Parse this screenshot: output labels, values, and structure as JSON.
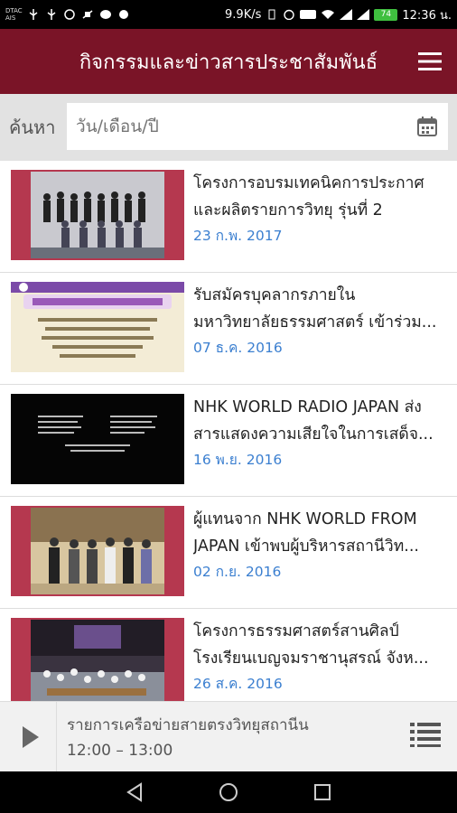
{
  "status_bar": {
    "carrier": "DTAC\nAIS",
    "speed": "9.9K/s",
    "battery": "74",
    "time": "12:36 น."
  },
  "app_bar": {
    "title": "กิจกรรมและข่าวสารประชาสัมพันธ์",
    "menu_icon": "hamburger-menu-icon"
  },
  "search": {
    "label": "ค้นหา",
    "placeholder": "วัน/เดือน/ปี",
    "calendar_icon": "calendar-icon"
  },
  "news": [
    {
      "line1": "โครงการอบรมเทคนิคการประกาศ",
      "line2": "และผลิตรายการวิทยุ รุ่นที่ 2",
      "date": "23 ก.พ. 2017"
    },
    {
      "line1": "รับสมัครบุคลากรภายใน",
      "line2": "มหาวิทยาลัยธรรมศาสตร์ เข้าร่วม...",
      "date": "07 ธ.ค. 2016"
    },
    {
      "line1": "NHK WORLD RADIO JAPAN ส่ง",
      "line2": "สารแสดงความเสียใจในการเสด็จ...",
      "date": "16 พ.ย. 2016"
    },
    {
      "line1": "ผู้แทนจาก NHK WORLD FROM",
      "line2": "JAPAN เข้าพบผู้บริหารสถานีวิท...",
      "date": "02 ก.ย. 2016"
    },
    {
      "line1": "โครงการธรรมศาสตร์สานศิลป์",
      "line2": "โรงเรียนเบญจมราชานุสรณ์ จังห...",
      "date": "26 ส.ค. 2016"
    }
  ],
  "player": {
    "program": "รายการเครือข่ายสายตรงวิทยุสถานีน",
    "time": "12:00  –  13:00",
    "play_icon": "play-icon",
    "playlist_icon": "playlist-icon"
  },
  "colors": {
    "brand": "#7a1427",
    "date": "#3b7fd0",
    "thumb_frame": "#b5384f"
  }
}
